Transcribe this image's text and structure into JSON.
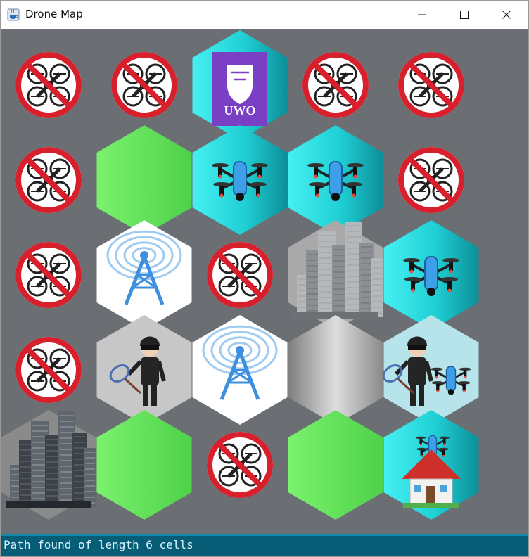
{
  "window": {
    "title": "Drone Map",
    "icon": "java-cup-icon",
    "controls": [
      "minimize-icon",
      "maximize-icon",
      "close-icon"
    ]
  },
  "map": {
    "rows": [
      [
        "no-fly",
        "no-fly",
        "start-uwo",
        "no-fly",
        "no-fly"
      ],
      [
        "no-fly",
        "free-green",
        "drone",
        "drone",
        "no-fly"
      ],
      [
        "no-fly",
        "tower",
        "no-fly",
        "city-gray",
        "drone"
      ],
      [
        "no-fly",
        "thief",
        "tower",
        "empty-gray",
        "thief-drone"
      ],
      [
        "city-dark",
        "free-green",
        "no-fly",
        "free-green",
        "drone-home"
      ]
    ],
    "start_label": "UWO"
  },
  "status": {
    "text": "Path found of length 6 cells"
  },
  "colors": {
    "background": "#6b6e73",
    "green": "#66e55f",
    "teal": "#1fcfd4",
    "status_bar": "#075d75",
    "uwo_purple": "#7b3fc6",
    "no_fly_red": "#d8202c"
  }
}
